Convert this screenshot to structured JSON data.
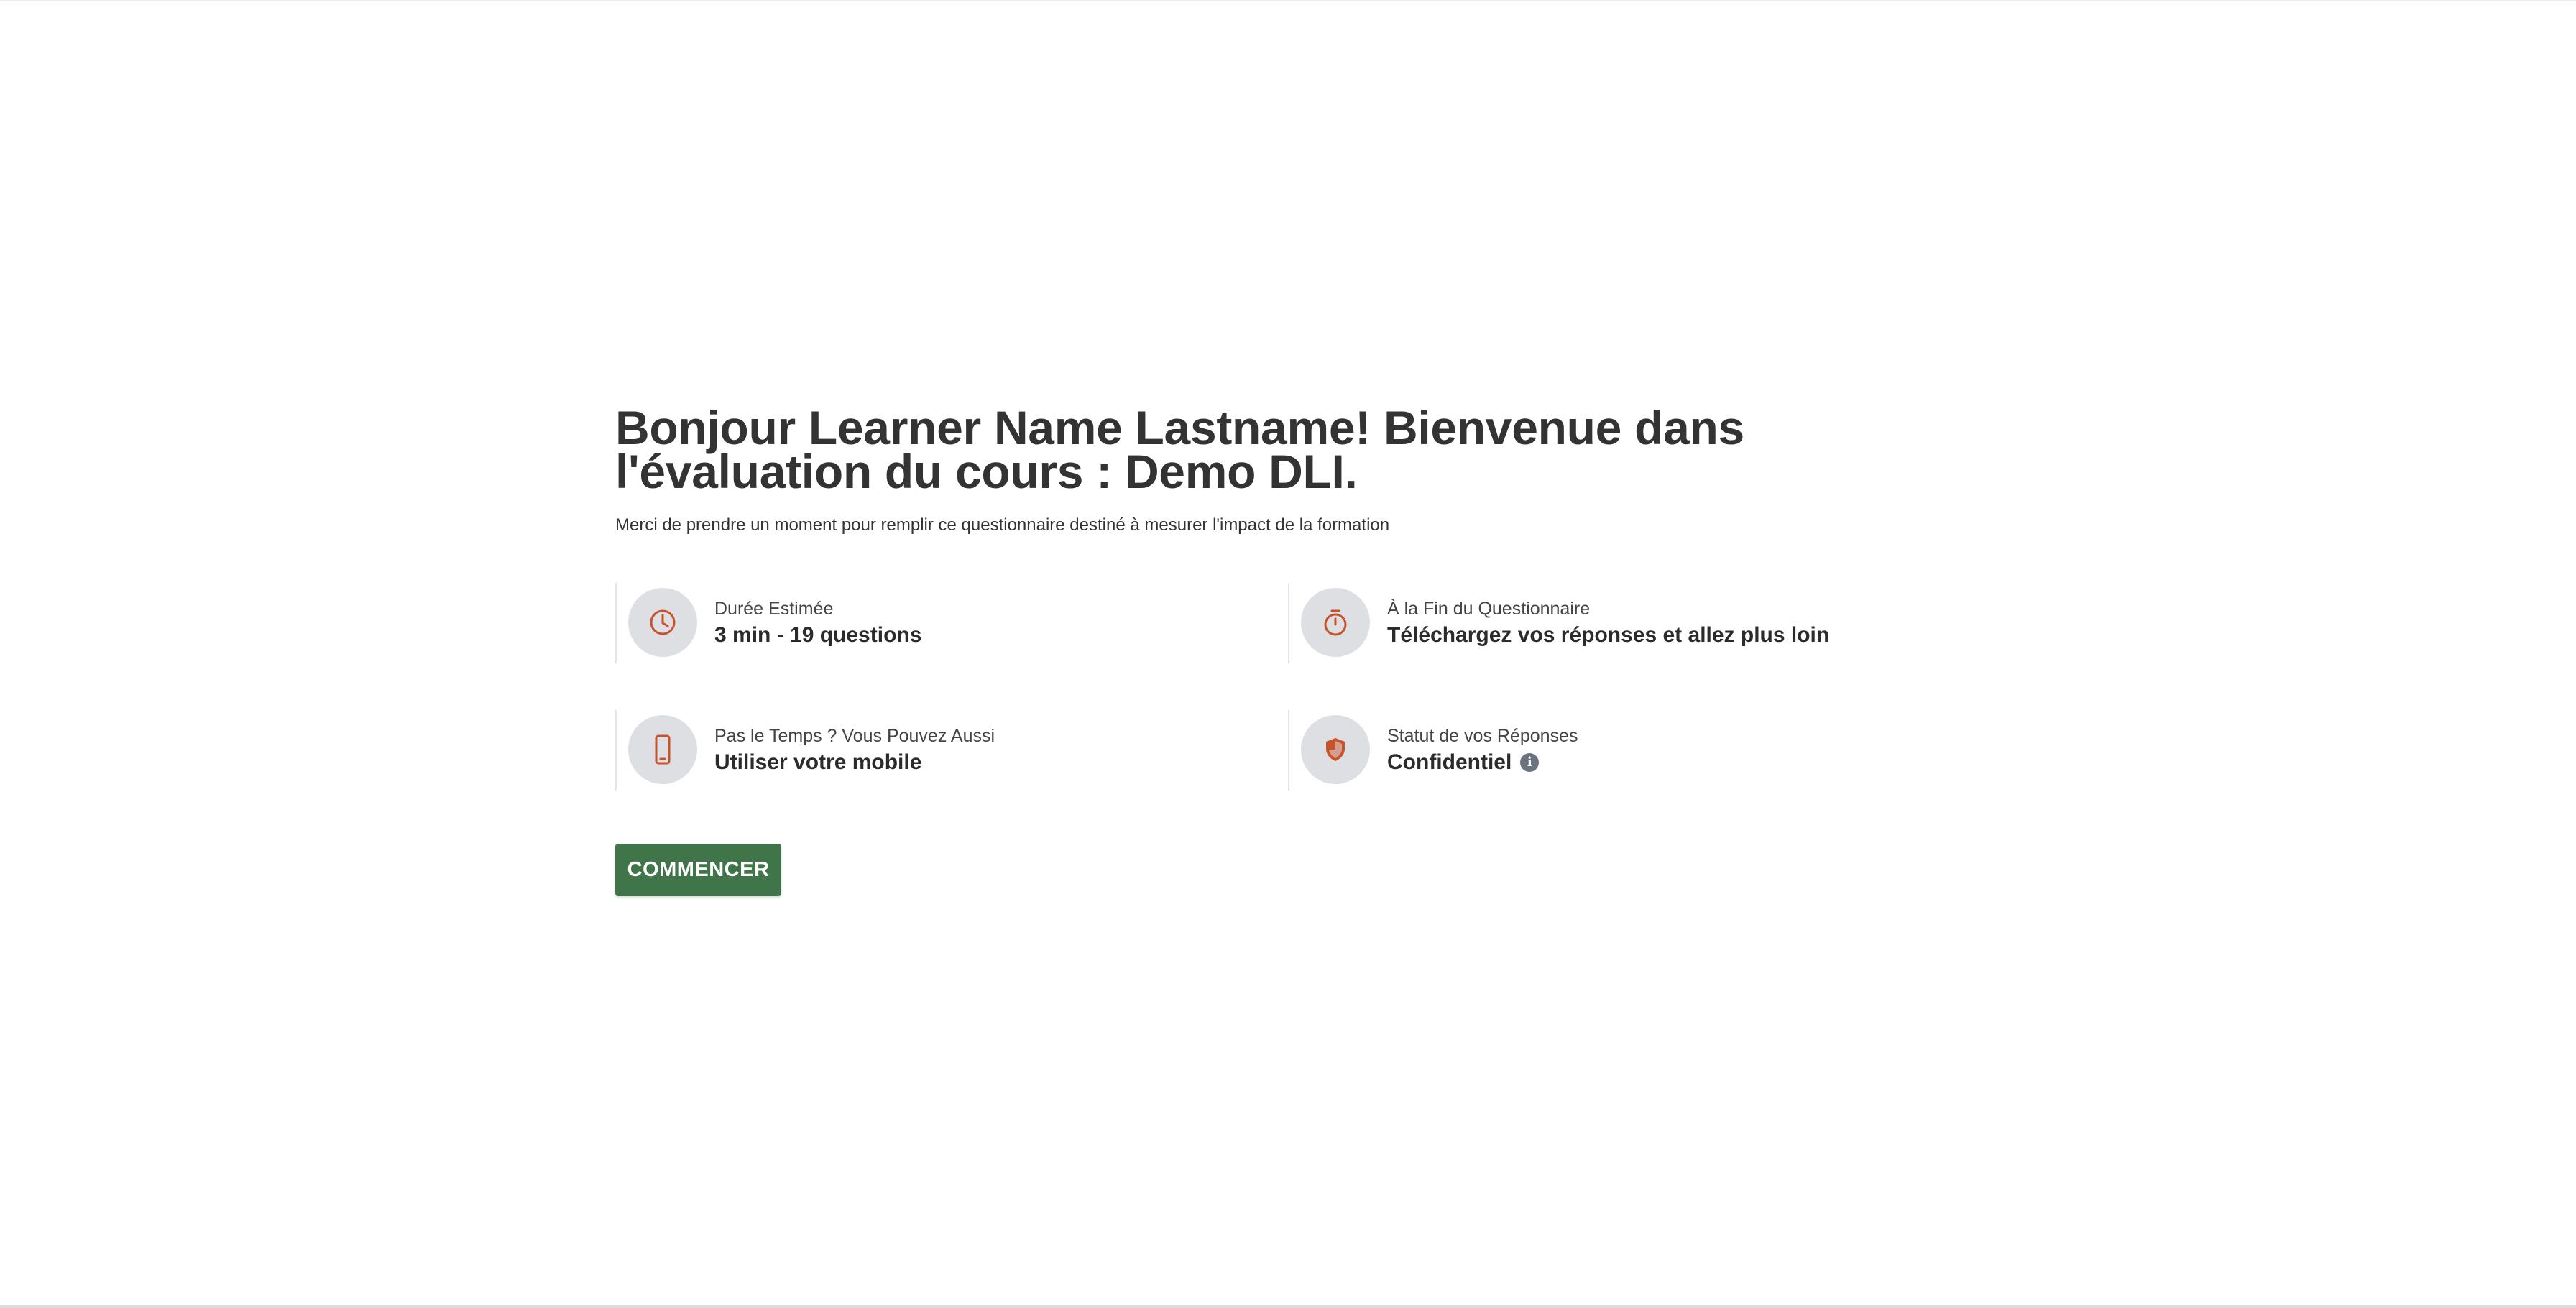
{
  "page": {
    "title": "Bonjour Learner Name Lastname! Bienvenue dans l'évaluation du cours : Demo DLI.",
    "subtitle": "Merci de prendre un moment pour remplir ce questionnaire destiné à mesurer l'impact de la formation"
  },
  "cards": [
    {
      "label": "Durée Estimée",
      "value": "3 min - 19 questions",
      "icon": "clock-icon"
    },
    {
      "label": "À la Fin du Questionnaire",
      "value": "Téléchargez vos réponses et allez plus loin",
      "icon": "stopwatch-icon"
    },
    {
      "label": "Pas le Temps ? Vous Pouvez Aussi",
      "value": "Utiliser votre mobile",
      "icon": "mobile-phone-icon"
    },
    {
      "label": "Statut de vos Réponses",
      "value": "Confidentiel",
      "icon": "shield-icon"
    }
  ],
  "info_icon_glyph": "i",
  "start_button": {
    "label": "COMMENCER"
  },
  "colors": {
    "accent_icon": "#c8532a",
    "icon_background": "#dedfe3",
    "button_background": "#3f7548",
    "button_text": "#ffffff",
    "info_icon": "#6b7280"
  }
}
